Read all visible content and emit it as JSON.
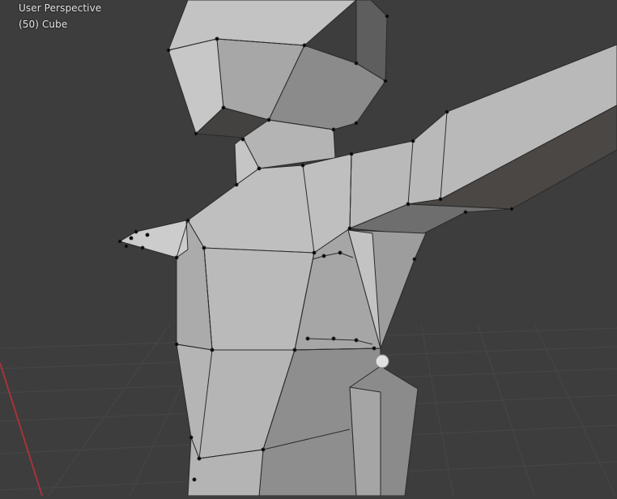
{
  "viewport": {
    "view_label": "User Perspective",
    "object_label": "(50) Cube",
    "colors": {
      "background": "#3d3d3d",
      "grid": "#484848",
      "x_axis": "#a8323a",
      "vertex": "#000000",
      "edge": "#2a2a2a"
    },
    "scene_objects": [
      "mesh-cube-character",
      "armature-bone"
    ]
  }
}
